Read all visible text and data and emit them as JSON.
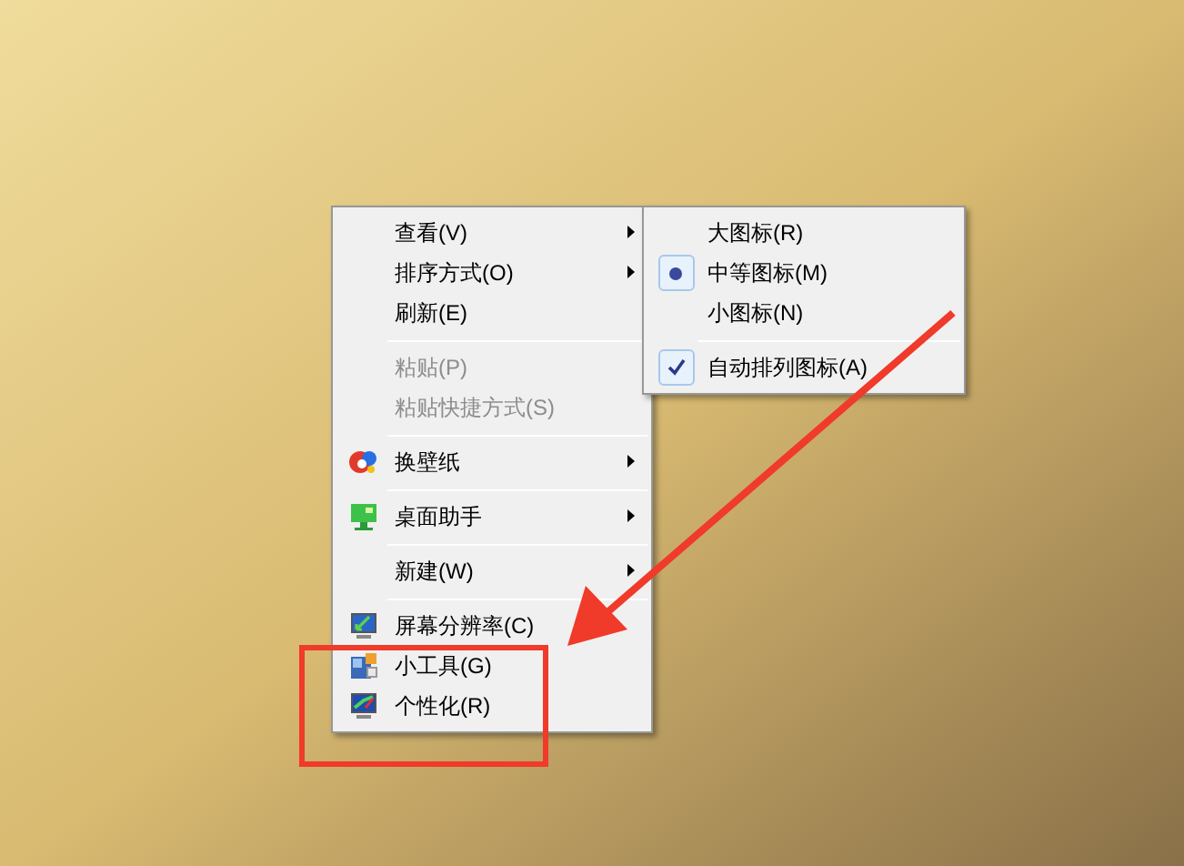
{
  "context_menu": {
    "items": [
      {
        "kind": "item",
        "label": "查看(V)",
        "disabled": false,
        "submenu": true,
        "icon": false
      },
      {
        "kind": "item",
        "label": "排序方式(O)",
        "disabled": false,
        "submenu": true,
        "icon": false
      },
      {
        "kind": "item",
        "label": "刷新(E)",
        "disabled": false,
        "submenu": false,
        "icon": false
      },
      {
        "kind": "separator"
      },
      {
        "kind": "item",
        "label": "粘贴(P)",
        "disabled": true,
        "submenu": false,
        "icon": false
      },
      {
        "kind": "item",
        "label": "粘贴快捷方式(S)",
        "disabled": true,
        "submenu": false,
        "icon": false
      },
      {
        "kind": "separator"
      },
      {
        "kind": "item",
        "label": "换壁纸",
        "disabled": false,
        "submenu": true,
        "icon": true
      },
      {
        "kind": "separator"
      },
      {
        "kind": "item",
        "label": "桌面助手",
        "disabled": false,
        "submenu": true,
        "icon": true
      },
      {
        "kind": "separator"
      },
      {
        "kind": "item",
        "label": "新建(W)",
        "disabled": false,
        "submenu": true,
        "icon": false
      },
      {
        "kind": "separator"
      },
      {
        "kind": "item",
        "label": "屏幕分辨率(C)",
        "disabled": false,
        "submenu": false,
        "icon": true
      },
      {
        "kind": "item",
        "label": "小工具(G)",
        "disabled": false,
        "submenu": false,
        "icon": true
      },
      {
        "kind": "item",
        "label": "个性化(R)",
        "disabled": false,
        "submenu": false,
        "icon": true
      }
    ]
  },
  "view_submenu": {
    "items": [
      {
        "kind": "radio",
        "label": "大图标(R)",
        "selected": false
      },
      {
        "kind": "radio",
        "label": "中等图标(M)",
        "selected": true
      },
      {
        "kind": "radio",
        "label": "小图标(N)",
        "selected": false
      },
      {
        "kind": "separator"
      },
      {
        "kind": "check",
        "label": "自动排列图标(A)",
        "checked": true
      }
    ]
  }
}
